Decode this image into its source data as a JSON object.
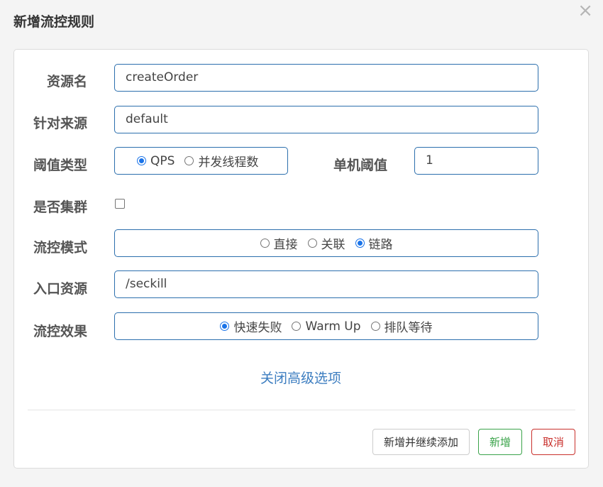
{
  "dialog": {
    "title": "新增流控规则",
    "close_glyph": "×",
    "close_icon": "close-icon"
  },
  "form": {
    "resource": {
      "label": "资源名",
      "value": "createOrder"
    },
    "origin": {
      "label": "针对来源",
      "value": "default"
    },
    "threshold_type": {
      "label": "阈值类型",
      "options": [
        "QPS",
        "并发线程数"
      ],
      "selected": "QPS"
    },
    "single_threshold": {
      "label": "单机阈值",
      "value": "1"
    },
    "cluster": {
      "label": "是否集群",
      "checked": false
    },
    "flow_mode": {
      "label": "流控模式",
      "options": [
        "直接",
        "关联",
        "链路"
      ],
      "selected": "链路"
    },
    "entry_resource": {
      "label": "入口资源",
      "value": "/seckill"
    },
    "control_effect": {
      "label": "流控效果",
      "options": [
        "快速失败",
        "Warm Up",
        "排队等待"
      ],
      "selected": "快速失败"
    }
  },
  "advanced_toggle": "关闭高级选项",
  "buttons": {
    "add_continue": "新增并继续添加",
    "add": "新增",
    "cancel": "取消"
  },
  "colors": {
    "primary_border": "#2c6fad",
    "link": "#3c7dc0",
    "success": "#3aa34a",
    "danger": "#c9302c",
    "radio_checked": "#1a73e8"
  }
}
